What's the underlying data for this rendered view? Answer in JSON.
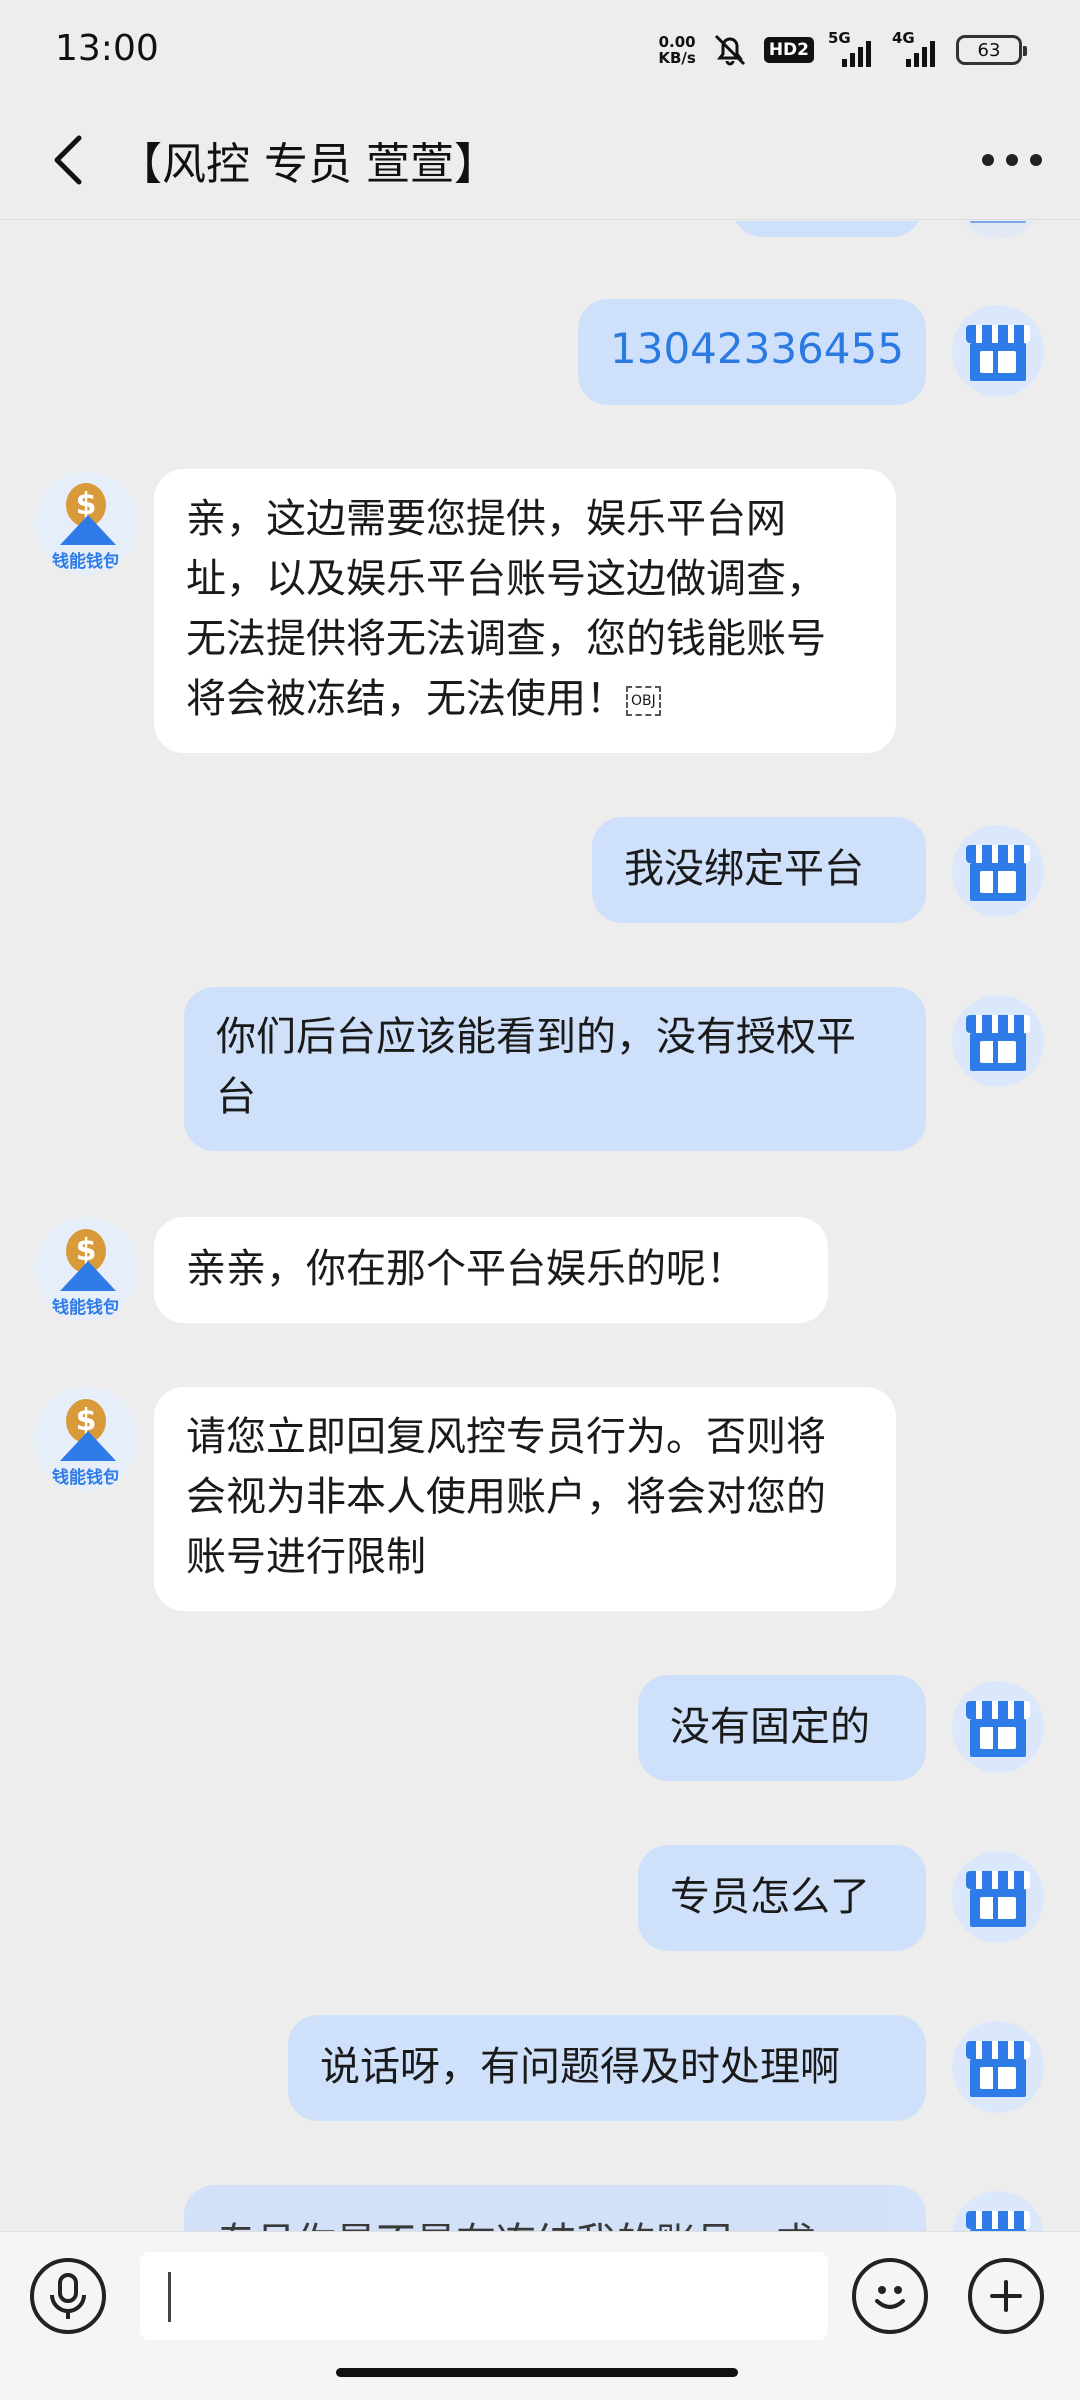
{
  "status": {
    "time": "13:00",
    "speed_value": "0.00",
    "speed_unit": "KB/s",
    "hd_label": "HD2",
    "net1_label": "5G",
    "net2_label": "4G",
    "battery": "63"
  },
  "header": {
    "title": "【风控 专员 萱萱】",
    "back_icon": "chevron-left-icon",
    "more_icon": "more-dots-icon"
  },
  "messages": [
    {
      "side": "out",
      "text": "13042336455"
    },
    {
      "side": "in",
      "text": "亲，这边需要您提供，娱乐平台网址，以及娱乐平台账号这边做调查，无法提供将无法调查，您的钱能账号将会被冻结，无法使用！",
      "obj_tag": "OBJ"
    },
    {
      "side": "out",
      "text": "我没绑定平台"
    },
    {
      "side": "out",
      "text": "你们后台应该能看到的，没有授权平台"
    },
    {
      "side": "in",
      "text": "亲亲，你在那个平台娱乐的呢！"
    },
    {
      "side": "in",
      "text": "请您立即回复风控专员行为。否则将会视为非本人使用账户，将会对您的账号进行限制"
    },
    {
      "side": "out",
      "text": "没有固定的"
    },
    {
      "side": "out",
      "text": "专员怎么了"
    },
    {
      "side": "out",
      "text": "说话呀，有问题得及时处理啊"
    },
    {
      "side": "out",
      "text": "专员你是不是在冻结我的账号，求"
    }
  ],
  "avatars": {
    "sender_logo_text": "钱能钱包",
    "self_icon": "store-icon"
  },
  "input_bar": {
    "voice_icon": "microphone-icon",
    "emoji_icon": "emoji-icon",
    "plus_icon": "plus-icon",
    "placeholder": ""
  },
  "colors": {
    "background": "#ededed",
    "outgoing_bubble": "#cfe0fa",
    "incoming_bubble": "#ffffff",
    "phone_link": "#2a7ae2"
  }
}
